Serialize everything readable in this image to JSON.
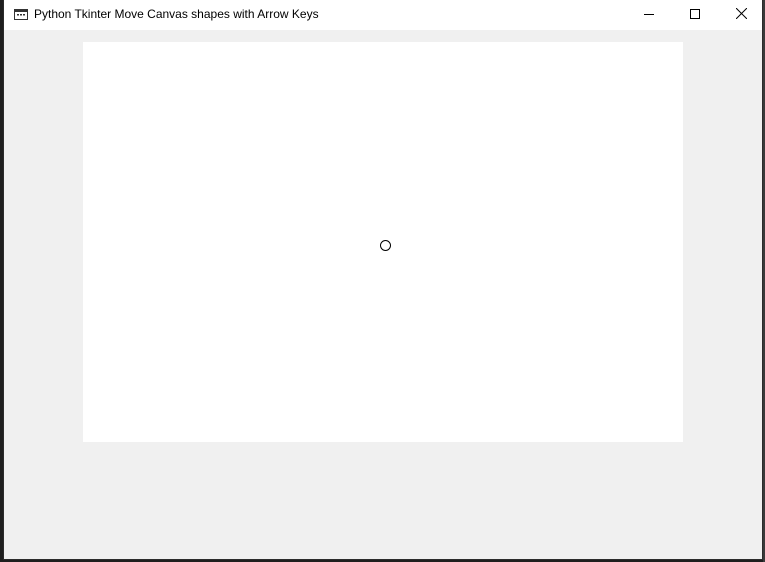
{
  "window": {
    "title": "Python Tkinter Move Canvas shapes with Arrow Keys",
    "icon": "tk-feather-icon",
    "controls": {
      "minimize_icon": "minimize-icon",
      "maximize_icon": "maximize-icon",
      "close_icon": "close-icon"
    }
  },
  "canvas": {
    "background": "#ffffff",
    "shapes": [
      {
        "type": "oval",
        "outline": "#000000",
        "fill": ""
      }
    ]
  },
  "colors": {
    "client_bg": "#f0f0f0",
    "titlebar_bg": "#ffffff",
    "close_hover": "#e81123"
  }
}
